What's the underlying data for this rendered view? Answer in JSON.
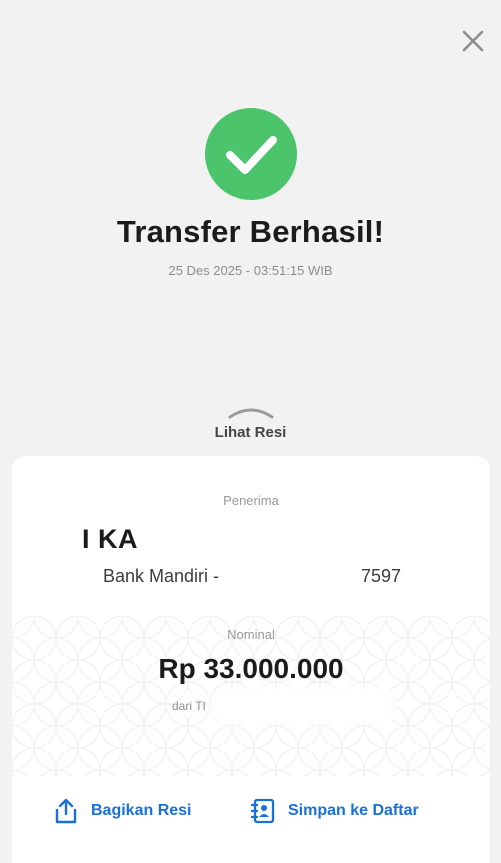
{
  "header": {
    "close_icon": "close-icon"
  },
  "status": {
    "icon": "checkmark-circle-icon",
    "title": "Transfer Berhasil!",
    "timestamp": "25 Des 2025 - 03:51:15 WIB",
    "colors": {
      "success": "#4cc46b"
    }
  },
  "receipt_toggle": {
    "icon": "chevron-up-icon",
    "label": "Lihat Resi"
  },
  "receipt": {
    "recipient_label": "Penerima",
    "recipient_name": "I KA",
    "bank_prefix": "Bank Mandiri -",
    "account_suffix": "7597",
    "nominal_label": "Nominal",
    "amount": "Rp 33.000.000",
    "source": "dari TI"
  },
  "actions": {
    "share": {
      "label": "Bagikan Resi",
      "icon": "share-icon"
    },
    "save": {
      "label": "Simpan ke Daftar",
      "icon": "contact-book-icon"
    },
    "accent": "#1a6fd8"
  }
}
